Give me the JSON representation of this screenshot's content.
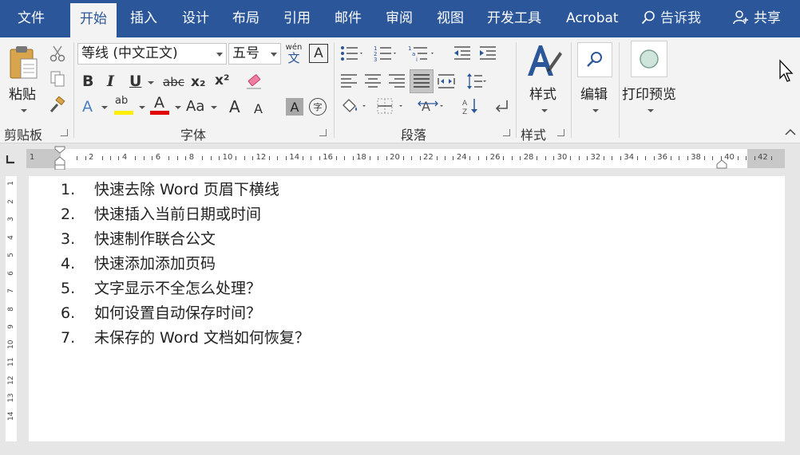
{
  "tabs": [
    {
      "label": "文件"
    },
    {
      "label": "开始"
    },
    {
      "label": "插入"
    },
    {
      "label": "设计"
    },
    {
      "label": "布局"
    },
    {
      "label": "引用"
    },
    {
      "label": "邮件"
    },
    {
      "label": "审阅"
    },
    {
      "label": "视图"
    },
    {
      "label": "开发工具"
    },
    {
      "label": "Acrobat"
    }
  ],
  "active_tab": "开始",
  "tell_me": "告诉我",
  "share": "共享",
  "clipboard": {
    "paste_label": "粘贴",
    "group_label": "剪贴板"
  },
  "font": {
    "name": "等线 (中文正文)",
    "size": "五号",
    "phonetic_top": "wén",
    "phonetic_bottom": "文",
    "border_char": "A",
    "group_label": "字体",
    "bold": "B",
    "italic": "I",
    "underline": "U",
    "strike": "abc",
    "subscript": "x₂",
    "superscript": "x²",
    "text_effect": "A",
    "highlight": "ab",
    "font_color": "A",
    "change_case": "Aa",
    "grow": "A",
    "shrink": "A",
    "shading": "A",
    "enclose": "字",
    "highlight_color": "#ffee00",
    "font_color_value": "#e00000"
  },
  "paragraph": {
    "group_label": "段落"
  },
  "styles": {
    "label": "样式",
    "group_label": "样式"
  },
  "editing": {
    "label": "编辑"
  },
  "print_preview": {
    "label": "打印预览"
  },
  "ruler": {
    "labels": [
      "2",
      "4",
      "6",
      "8",
      "10",
      "12",
      "14",
      "16",
      "18",
      "20",
      "22",
      "24",
      "26",
      "28",
      "30",
      "32",
      "34",
      "36",
      "38",
      "40",
      "42"
    ],
    "left_label": "1",
    "vertical_labels": [
      "1",
      "2",
      "3",
      "4",
      "5",
      "6",
      "7",
      "8",
      "9",
      "10",
      "11",
      "12",
      "13",
      "14"
    ]
  },
  "document": {
    "items": [
      {
        "num": "1.",
        "text": "快速去除 Word 页眉下横线"
      },
      {
        "num": "2.",
        "text": "快速插入当前日期或时间"
      },
      {
        "num": "3.",
        "text": "快速制作联合公文"
      },
      {
        "num": "4.",
        "text": "快速添加添加页码"
      },
      {
        "num": "5.",
        "text": "文字显示不全怎么处理？"
      },
      {
        "num": "6.",
        "text": "如何设置自动保存时间？"
      },
      {
        "num": "7.",
        "text": "未保存的 Word 文档如何恢复？"
      }
    ]
  },
  "colors": {
    "tab_bar": "#2b579a",
    "ribbon": "#f3f3f3",
    "accent": "#2b579a"
  }
}
